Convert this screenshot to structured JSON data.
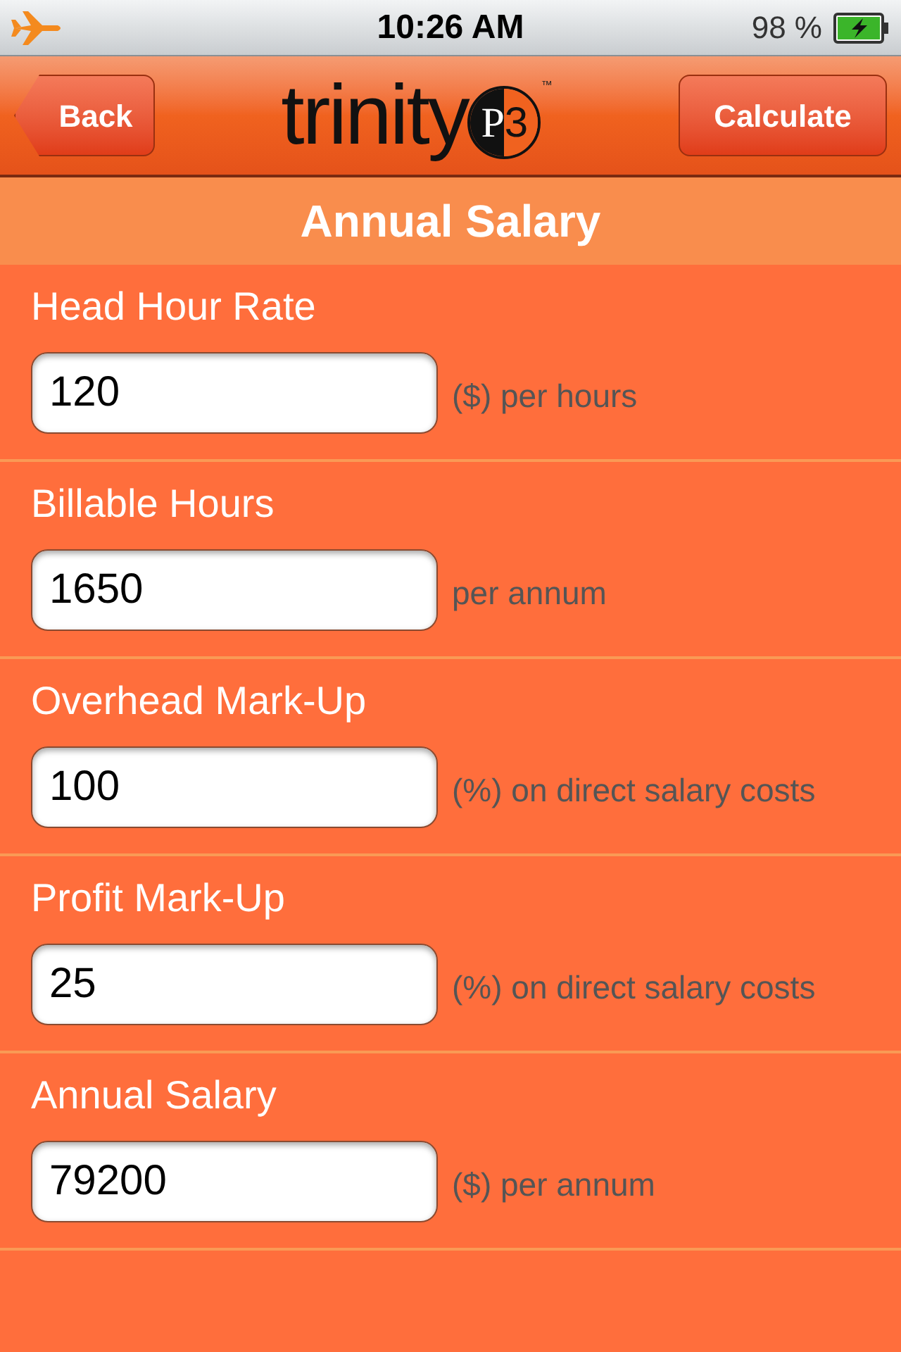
{
  "status_bar": {
    "time": "10:26 AM",
    "battery": "98 %"
  },
  "nav_bar": {
    "back_button": "Back",
    "logo": {
      "word": "trinity",
      "badge_letter": "P",
      "badge_digit": "3",
      "trademark": "™"
    },
    "action_button": "Calculate"
  },
  "section_title": "Annual Salary",
  "fields": [
    {
      "label": "Head Hour Rate",
      "value": "120",
      "unit": "($) per hours"
    },
    {
      "label": "Billable Hours",
      "value": "1650",
      "unit": "per annum"
    },
    {
      "label": "Overhead Mark-Up",
      "value": "100",
      "unit": "(%) on direct salary costs"
    },
    {
      "label": "Profit Mark-Up",
      "value": "25",
      "unit": "(%) on direct salary costs"
    },
    {
      "label": "Annual Salary",
      "value": "79200",
      "unit": "($) per annum"
    }
  ]
}
